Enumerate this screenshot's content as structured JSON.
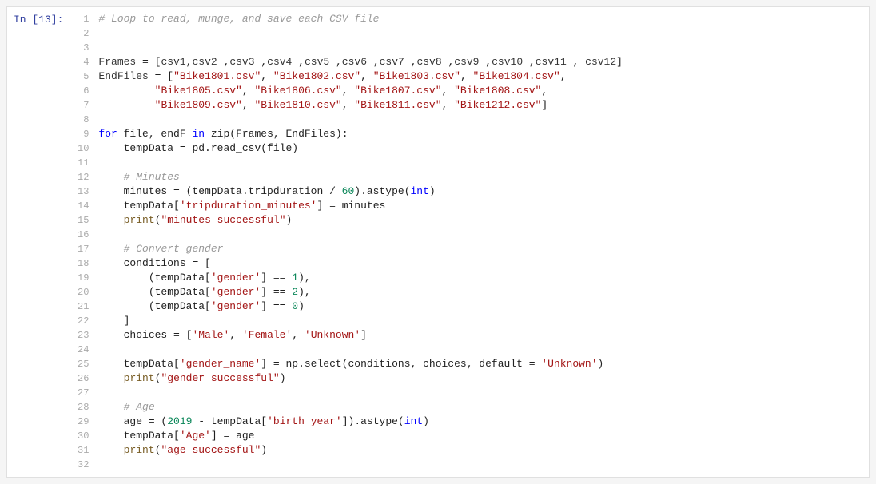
{
  "cell": {
    "label": "In [13]:",
    "lines": [
      {
        "num": 1,
        "tokens": [
          {
            "text": "# Loop to read, munge, and save each CSV file",
            "cls": "c-comment"
          }
        ]
      },
      {
        "num": 2,
        "tokens": []
      },
      {
        "num": 3,
        "tokens": []
      },
      {
        "num": 4,
        "tokens": [
          {
            "text": "Frames",
            "cls": "c-variable"
          },
          {
            "text": " = [",
            "cls": "c-dark"
          },
          {
            "text": "csv1",
            "cls": "c-variable"
          },
          {
            "text": ",",
            "cls": "c-dark"
          },
          {
            "text": "csv2",
            "cls": "c-variable"
          },
          {
            "text": " ,",
            "cls": "c-dark"
          },
          {
            "text": "csv3",
            "cls": "c-variable"
          },
          {
            "text": " ,",
            "cls": "c-dark"
          },
          {
            "text": "csv4",
            "cls": "c-variable"
          },
          {
            "text": " ,",
            "cls": "c-dark"
          },
          {
            "text": "csv5",
            "cls": "c-variable"
          },
          {
            "text": " ,",
            "cls": "c-dark"
          },
          {
            "text": "csv6",
            "cls": "c-variable"
          },
          {
            "text": " ,",
            "cls": "c-dark"
          },
          {
            "text": "csv7",
            "cls": "c-variable"
          },
          {
            "text": " ,",
            "cls": "c-dark"
          },
          {
            "text": "csv8",
            "cls": "c-variable"
          },
          {
            "text": " ,",
            "cls": "c-dark"
          },
          {
            "text": "csv9",
            "cls": "c-variable"
          },
          {
            "text": " ,",
            "cls": "c-dark"
          },
          {
            "text": "csv10",
            "cls": "c-variable"
          },
          {
            "text": " ,",
            "cls": "c-dark"
          },
          {
            "text": "csv11",
            "cls": "c-variable"
          },
          {
            "text": " , ",
            "cls": "c-dark"
          },
          {
            "text": "csv12",
            "cls": "c-variable"
          },
          {
            "text": "]",
            "cls": "c-dark"
          }
        ]
      },
      {
        "num": 5,
        "tokens": [
          {
            "text": "EndFiles",
            "cls": "c-variable"
          },
          {
            "text": " = [",
            "cls": "c-dark"
          },
          {
            "text": "\"Bike1801.csv\"",
            "cls": "c-string"
          },
          {
            "text": ", ",
            "cls": "c-dark"
          },
          {
            "text": "\"Bike1802.csv\"",
            "cls": "c-string"
          },
          {
            "text": ", ",
            "cls": "c-dark"
          },
          {
            "text": "\"Bike1803.csv\"",
            "cls": "c-string"
          },
          {
            "text": ", ",
            "cls": "c-dark"
          },
          {
            "text": "\"Bike1804.csv\"",
            "cls": "c-string"
          },
          {
            "text": ",",
            "cls": "c-dark"
          }
        ]
      },
      {
        "num": 6,
        "tokens": [
          {
            "text": "         ",
            "cls": "c-dark"
          },
          {
            "text": "\"Bike1805.csv\"",
            "cls": "c-string"
          },
          {
            "text": ", ",
            "cls": "c-dark"
          },
          {
            "text": "\"Bike1806.csv\"",
            "cls": "c-string"
          },
          {
            "text": ", ",
            "cls": "c-dark"
          },
          {
            "text": "\"Bike1807.csv\"",
            "cls": "c-string"
          },
          {
            "text": ", ",
            "cls": "c-dark"
          },
          {
            "text": "\"Bike1808.csv\"",
            "cls": "c-string"
          },
          {
            "text": ",",
            "cls": "c-dark"
          }
        ]
      },
      {
        "num": 7,
        "tokens": [
          {
            "text": "         ",
            "cls": "c-dark"
          },
          {
            "text": "\"Bike1809.csv\"",
            "cls": "c-string"
          },
          {
            "text": ", ",
            "cls": "c-dark"
          },
          {
            "text": "\"Bike1810.csv\"",
            "cls": "c-string"
          },
          {
            "text": ", ",
            "cls": "c-dark"
          },
          {
            "text": "\"Bike1811.csv\"",
            "cls": "c-string"
          },
          {
            "text": ", ",
            "cls": "c-dark"
          },
          {
            "text": "\"Bike1212.csv\"",
            "cls": "c-string"
          },
          {
            "text": "]",
            "cls": "c-dark"
          }
        ]
      },
      {
        "num": 8,
        "tokens": []
      },
      {
        "num": 9,
        "tokens": [
          {
            "text": "for",
            "cls": "c-keyword"
          },
          {
            "text": " file, endF ",
            "cls": "c-dark"
          },
          {
            "text": "in",
            "cls": "c-keyword"
          },
          {
            "text": " zip(Frames, EndFiles):",
            "cls": "c-dark"
          }
        ]
      },
      {
        "num": 10,
        "tokens": [
          {
            "text": "    tempData = pd.read_csv(file)",
            "cls": "c-dark"
          }
        ]
      },
      {
        "num": 11,
        "tokens": []
      },
      {
        "num": 12,
        "tokens": [
          {
            "text": "    ",
            "cls": "c-dark"
          },
          {
            "text": "# Minutes",
            "cls": "c-comment"
          }
        ]
      },
      {
        "num": 13,
        "tokens": [
          {
            "text": "    minutes = (tempData.tripduration / ",
            "cls": "c-dark"
          },
          {
            "text": "60",
            "cls": "c-number"
          },
          {
            "text": ").astype(",
            "cls": "c-dark"
          },
          {
            "text": "int",
            "cls": "c-keyword"
          },
          {
            "text": ")",
            "cls": "c-dark"
          }
        ]
      },
      {
        "num": 14,
        "tokens": [
          {
            "text": "    tempData[",
            "cls": "c-dark"
          },
          {
            "text": "'tripduration_minutes'",
            "cls": "c-string"
          },
          {
            "text": "] = minutes",
            "cls": "c-dark"
          }
        ]
      },
      {
        "num": 15,
        "tokens": [
          {
            "text": "    ",
            "cls": "c-dark"
          },
          {
            "text": "print",
            "cls": "c-function"
          },
          {
            "text": "(",
            "cls": "c-dark"
          },
          {
            "text": "\"minutes successful\"",
            "cls": "c-string"
          },
          {
            "text": ")",
            "cls": "c-dark"
          }
        ]
      },
      {
        "num": 16,
        "tokens": []
      },
      {
        "num": 17,
        "tokens": [
          {
            "text": "    ",
            "cls": "c-dark"
          },
          {
            "text": "# Convert gender",
            "cls": "c-comment"
          }
        ]
      },
      {
        "num": 18,
        "tokens": [
          {
            "text": "    conditions = [",
            "cls": "c-dark"
          }
        ]
      },
      {
        "num": 19,
        "tokens": [
          {
            "text": "        (tempData[",
            "cls": "c-dark"
          },
          {
            "text": "'gender'",
            "cls": "c-string"
          },
          {
            "text": "] == ",
            "cls": "c-dark"
          },
          {
            "text": "1",
            "cls": "c-number"
          },
          {
            "text": "),",
            "cls": "c-dark"
          }
        ]
      },
      {
        "num": 20,
        "tokens": [
          {
            "text": "        (tempData[",
            "cls": "c-dark"
          },
          {
            "text": "'gender'",
            "cls": "c-string"
          },
          {
            "text": "] == ",
            "cls": "c-dark"
          },
          {
            "text": "2",
            "cls": "c-number"
          },
          {
            "text": "),",
            "cls": "c-dark"
          }
        ]
      },
      {
        "num": 21,
        "tokens": [
          {
            "text": "        (tempData[",
            "cls": "c-dark"
          },
          {
            "text": "'gender'",
            "cls": "c-string"
          },
          {
            "text": "] == ",
            "cls": "c-dark"
          },
          {
            "text": "0",
            "cls": "c-number"
          },
          {
            "text": ")",
            "cls": "c-dark"
          }
        ]
      },
      {
        "num": 22,
        "tokens": [
          {
            "text": "    ]",
            "cls": "c-dark"
          }
        ]
      },
      {
        "num": 23,
        "tokens": [
          {
            "text": "    choices = [",
            "cls": "c-dark"
          },
          {
            "text": "'Male'",
            "cls": "c-string"
          },
          {
            "text": ", ",
            "cls": "c-dark"
          },
          {
            "text": "'Female'",
            "cls": "c-string"
          },
          {
            "text": ", ",
            "cls": "c-dark"
          },
          {
            "text": "'Unknown'",
            "cls": "c-string"
          },
          {
            "text": "]",
            "cls": "c-dark"
          }
        ]
      },
      {
        "num": 24,
        "tokens": []
      },
      {
        "num": 25,
        "tokens": [
          {
            "text": "    tempData[",
            "cls": "c-dark"
          },
          {
            "text": "'gender_name'",
            "cls": "c-string"
          },
          {
            "text": "] = np.select(conditions, choices, default = ",
            "cls": "c-dark"
          },
          {
            "text": "'Unknown'",
            "cls": "c-string"
          },
          {
            "text": ")",
            "cls": "c-dark"
          }
        ]
      },
      {
        "num": 26,
        "tokens": [
          {
            "text": "    ",
            "cls": "c-dark"
          },
          {
            "text": "print",
            "cls": "c-function"
          },
          {
            "text": "(",
            "cls": "c-dark"
          },
          {
            "text": "\"gender successful\"",
            "cls": "c-string"
          },
          {
            "text": ")",
            "cls": "c-dark"
          }
        ]
      },
      {
        "num": 27,
        "tokens": []
      },
      {
        "num": 28,
        "tokens": [
          {
            "text": "    ",
            "cls": "c-dark"
          },
          {
            "text": "# Age",
            "cls": "c-comment"
          }
        ]
      },
      {
        "num": 29,
        "tokens": [
          {
            "text": "    age = (",
            "cls": "c-dark"
          },
          {
            "text": "2019",
            "cls": "c-number"
          },
          {
            "text": " - tempData[",
            "cls": "c-dark"
          },
          {
            "text": "'birth year'",
            "cls": "c-string"
          },
          {
            "text": "]).astype(",
            "cls": "c-dark"
          },
          {
            "text": "int",
            "cls": "c-keyword"
          },
          {
            "text": ")",
            "cls": "c-dark"
          }
        ]
      },
      {
        "num": 30,
        "tokens": [
          {
            "text": "    tempData[",
            "cls": "c-dark"
          },
          {
            "text": "'Age'",
            "cls": "c-string"
          },
          {
            "text": "] = age",
            "cls": "c-dark"
          }
        ]
      },
      {
        "num": 31,
        "tokens": [
          {
            "text": "    ",
            "cls": "c-dark"
          },
          {
            "text": "print",
            "cls": "c-function"
          },
          {
            "text": "(",
            "cls": "c-dark"
          },
          {
            "text": "\"age successful\"",
            "cls": "c-string"
          },
          {
            "text": ")",
            "cls": "c-dark"
          }
        ]
      },
      {
        "num": 32,
        "tokens": []
      }
    ]
  }
}
